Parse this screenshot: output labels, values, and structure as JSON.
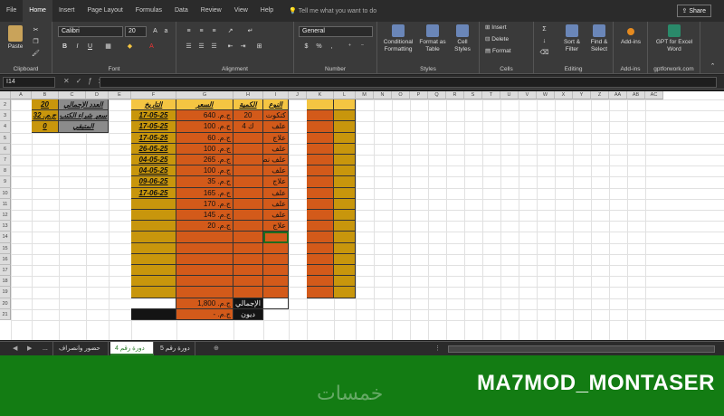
{
  "tabs": [
    "File",
    "Home",
    "Insert",
    "Page Layout",
    "Formulas",
    "Data",
    "Review",
    "View",
    "Help"
  ],
  "active_tab": "Home",
  "tell_me": "Tell me what you want to do",
  "share": "Share",
  "ribbon": {
    "paste": "Paste",
    "font_name": "Calibri",
    "font_size": "20",
    "number_format": "General",
    "conditional": "Conditional Formatting",
    "format_table": "Format as Table",
    "cell_styles": "Cell Styles",
    "insert": "Insert",
    "delete": "Delete",
    "format": "Format",
    "sort_filter": "Sort & Filter",
    "find_select": "Find & Select",
    "addins": "Add-ins",
    "gpt": "GPT for Excel Word",
    "gpt_url": "gptforwork.com",
    "groups": [
      "Clipboard",
      "Font",
      "Alignment",
      "Number",
      "Styles",
      "Cells",
      "Editing",
      "Add-ins",
      "gptforwork.com"
    ]
  },
  "name_box": "I14",
  "columns": [
    "A",
    "B",
    "C",
    "D",
    "E",
    "F",
    "G",
    "H",
    "I",
    "J",
    "K",
    "L",
    "M",
    "N",
    "O",
    "P",
    "Q",
    "R",
    "S",
    "T",
    "U",
    "V",
    "W",
    "X",
    "Y",
    "Z",
    "AA",
    "AB",
    "AC"
  ],
  "rows": [
    "2",
    "3",
    "4",
    "5",
    "6",
    "7",
    "8",
    "9",
    "10",
    "11",
    "12",
    "13",
    "14",
    "15",
    "16",
    "17",
    "18",
    "19",
    "20",
    "21"
  ],
  "summary": {
    "total_label": "العدد الإجمالي",
    "total_value": "20",
    "cost_label": "سعر شراء الكتب",
    "cost_value": "ج.م. 32",
    "remain_label": "المتبقي",
    "remain_value": "0"
  },
  "table": {
    "headers": {
      "date": "التاريخ",
      "price": "السعر",
      "qty": "الكمية",
      "type": "النوع"
    },
    "rows": [
      {
        "date": "17-05-25",
        "price": "ج.م. 640",
        "qty": "20",
        "type": "كتكوت"
      },
      {
        "date": "17-05-25",
        "price": "ج.م. 100",
        "qty": "ك 4",
        "type": "علف"
      },
      {
        "date": "17-05-25",
        "price": "ج.م. 60",
        "qty": "",
        "type": "علاج"
      },
      {
        "date": "26-05-25",
        "price": "ج.م. 100",
        "qty": "",
        "type": "علف"
      },
      {
        "date": "04-05-25",
        "price": "ج.م. 265",
        "qty": "",
        "type": "علف نص شكارة"
      },
      {
        "date": "04-05-25",
        "price": "ج.م. 100",
        "qty": "",
        "type": "علف"
      },
      {
        "date": "09-06-25",
        "price": "ج.م. 35",
        "qty": "",
        "type": "علاج"
      },
      {
        "date": "17-06-25",
        "price": "ج.م. 165",
        "qty": "",
        "type": "علف"
      },
      {
        "date": "",
        "price": "ج.م. 170",
        "qty": "",
        "type": "علف"
      },
      {
        "date": "",
        "price": "ج.م. 145",
        "qty": "",
        "type": "علف"
      },
      {
        "date": "",
        "price": "ج.م. 20",
        "qty": "",
        "type": "علاج"
      }
    ],
    "total_label": "الإجمالي",
    "total_value": "ج.م. 1,800",
    "debt_label": "ديون",
    "debt_value": "ج.م. -"
  },
  "sheets": [
    "...",
    "حضور وانصراف",
    "دورة رقم 4",
    "دورة رقم 5"
  ],
  "active_sheet": "دورة رقم 4",
  "banner_brand": "MA7MOD_MONTASER",
  "banner_watermark": "خمسات",
  "colors": {
    "orange": "#d35a1a",
    "yellow": "#f4c542",
    "banner": "#137c13"
  }
}
